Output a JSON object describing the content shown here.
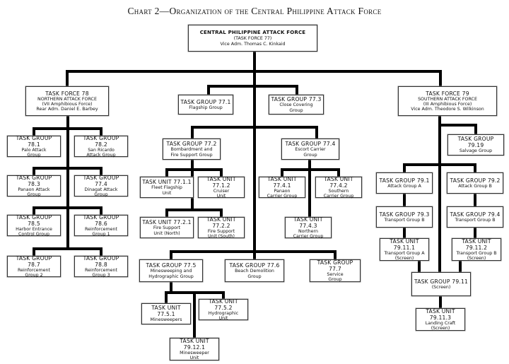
{
  "title": "Chart 2—Organization of the Central Philippine Attack Force",
  "nodes": {
    "tf77": {
      "head": "CENTRAL PHILIPPINE ATTACK FORCE",
      "lines": [
        "(TASK FORCE 77)",
        "Vice Adm. Thomas C. Kinkaid"
      ]
    },
    "tf78": {
      "head": "TASK FORCE 78",
      "lines": [
        "NORTHERN ATTACK FORCE",
        "(VII Amphibious Force)",
        "Rear Adm. Daniel E. Barbey"
      ]
    },
    "tg78_1": {
      "head": "TASK GROUP 78.1",
      "lines": [
        "Palo Attack",
        "Group"
      ]
    },
    "tg78_2": {
      "head": "TASK GROUP 78.2",
      "lines": [
        "San Ricardo",
        "Attack Group"
      ]
    },
    "tg78_3": {
      "head": "TASK GROUP 78.3",
      "lines": [
        "Panaon Attack",
        "Group"
      ]
    },
    "tg77_4_dinagat": {
      "head": "TASK GROUP 77.4",
      "lines": [
        "Dinagat Attack",
        "Group"
      ]
    },
    "tg78_5": {
      "head": "TASK GROUP 78.5",
      "lines": [
        "Harbor Entrance",
        "Control Group"
      ]
    },
    "tg78_6": {
      "head": "TASK GROUP 78.6",
      "lines": [
        "Reinforcement",
        "Group 1"
      ]
    },
    "tg78_7": {
      "head": "TASK GROUP 78.7",
      "lines": [
        "Reinforcement",
        "Group 2"
      ]
    },
    "tg78_8": {
      "head": "TASK GROUP 78.8",
      "lines": [
        "Reinforcement",
        "Group 3"
      ]
    },
    "tg77_1": {
      "head": "TASK GROUP 77.1",
      "lines": [
        "Flagship Group"
      ]
    },
    "tg77_3": {
      "head": "TASK GROUP 77.3",
      "lines": [
        "Close Covering",
        "Group"
      ]
    },
    "tg77_2": {
      "head": "TASK GROUP 77.2",
      "lines": [
        "Bombardment and",
        "Fire Support Group"
      ]
    },
    "tg77_4": {
      "head": "TASK GROUP 77.4",
      "lines": [
        "Escort Carrier",
        "Group"
      ]
    },
    "tu77_1_1": {
      "head": "TASK UNIT 77.1.1",
      "lines": [
        "Fleet Flagship",
        "Unit"
      ]
    },
    "tu77_1_2": {
      "head": "TASK UNIT 77.1.2",
      "lines": [
        "Cruiser",
        "Unit"
      ]
    },
    "tu77_2_1": {
      "head": "TASK UNIT 77.2.1",
      "lines": [
        "Fire Support",
        "Unit (North)"
      ]
    },
    "tu77_2_2": {
      "head": "TASK UNIT 77.2.2",
      "lines": [
        "Fire Support",
        "Unit (South)"
      ]
    },
    "tu77_4_1": {
      "head": "TASK UNIT 77.4.1",
      "lines": [
        "Panaon",
        "Carrier Group"
      ]
    },
    "tu77_4_2": {
      "head": "TASK UNIT 77.4.2",
      "lines": [
        "Southern",
        "Carrier Group"
      ]
    },
    "tu77_4_3": {
      "head": "TASK UNIT 77.4.3",
      "lines": [
        "Northern",
        "Carrier Group"
      ]
    },
    "tg77_5": {
      "head": "TASK GROUP 77.5",
      "lines": [
        "Minesweeping and",
        "Hydrographic Group"
      ]
    },
    "tg77_6": {
      "head": "TASK GROUP 77.6",
      "lines": [
        "Beach Demolition",
        "Group"
      ]
    },
    "tg77_7": {
      "head": "TASK GROUP 77.7",
      "lines": [
        "Service",
        "Group"
      ]
    },
    "tu77_5_1": {
      "head": "TASK UNIT 77.5.1",
      "lines": [
        "Minesweepers"
      ]
    },
    "tu77_5_2": {
      "head": "TASK UNIT 77.5.2",
      "lines": [
        "Hydrographic",
        "Unit"
      ]
    },
    "tu79_12_1": {
      "head": "TASK UNIT 79.12.1",
      "lines": [
        "Minesweeper",
        "Unit"
      ]
    },
    "tf79": {
      "head": "TASK FORCE 79",
      "lines": [
        "SOUTHERN ATTACK FORCE",
        "(III Amphibious Force)",
        "Vice Adm. Theodore S. Wilkinson"
      ]
    },
    "tg79_19": {
      "head": "TASK GROUP 79.19",
      "lines": [
        "Salvage Group"
      ]
    },
    "tg79_1": {
      "head": "TASK GROUP 79.1",
      "lines": [
        "Attack Group A"
      ]
    },
    "tg79_2": {
      "head": "TASK GROUP 79.2",
      "lines": [
        "Attack Group B"
      ]
    },
    "tg79_3": {
      "head": "TASK GROUP 79.3",
      "lines": [
        "Transport Group B"
      ]
    },
    "tg79_4": {
      "head": "TASK GROUP 79.4",
      "lines": [
        "Transport Group B"
      ]
    },
    "tu79_11_1": {
      "head": "TASK UNIT 79.11.1",
      "lines": [
        "Transport Group A",
        "(Screen)"
      ]
    },
    "tu79_11_2": {
      "head": "TASK UNIT 79.11.2",
      "lines": [
        "Transport Group B",
        "(Screen)"
      ]
    },
    "tg79_11": {
      "head": "TASK GROUP 79.11",
      "lines": [
        "(Screen)"
      ]
    },
    "tu79_11_3": {
      "head": "TASK UNIT 79.11.3",
      "lines": [
        "Landing Craft",
        "(Screen)"
      ]
    }
  }
}
